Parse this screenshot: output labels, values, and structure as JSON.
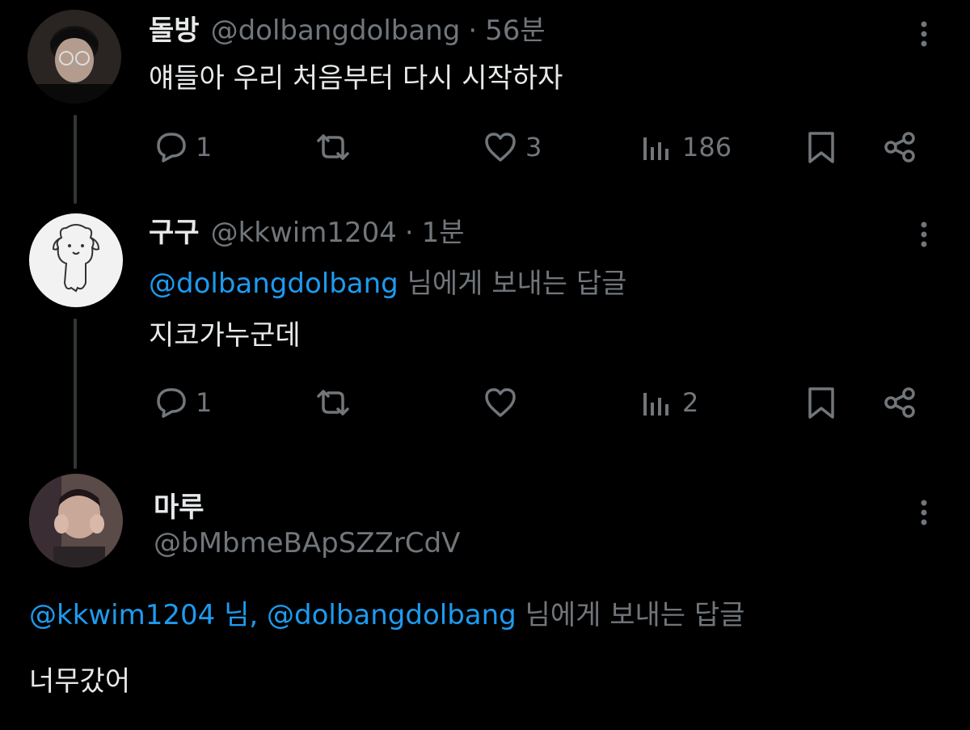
{
  "tweets": [
    {
      "name": "돌방",
      "handle": "@dolbangdolbang",
      "dot": "·",
      "time": "56분",
      "text": "얘들아 우리 처음부터 다시 시작하자",
      "replies": "1",
      "retweets": "",
      "likes": "3",
      "views": "186"
    },
    {
      "name": "구구",
      "handle": "@kkwim1204",
      "dot": "·",
      "time": "1분",
      "reply_mention": "@dolbangdolbang",
      "reply_suffix": " 님에게 보내는 답글",
      "text": "지코가누군데",
      "replies": "1",
      "retweets": "",
      "likes": "",
      "views": "2"
    }
  ],
  "focused": {
    "name": "마루",
    "handle": "@bMbmeBApSZZrCdV",
    "reply_mention_1": "@kkwim1204 님, @dolbangdolbang",
    "reply_suffix": " 님에게 보내는 답글",
    "text": "너무갔어"
  },
  "colors": {
    "background": "#000000",
    "primary_text": "#e7e9ea",
    "secondary_text": "#71767b",
    "accent": "#1d9bf0",
    "thread_line": "#333639"
  }
}
